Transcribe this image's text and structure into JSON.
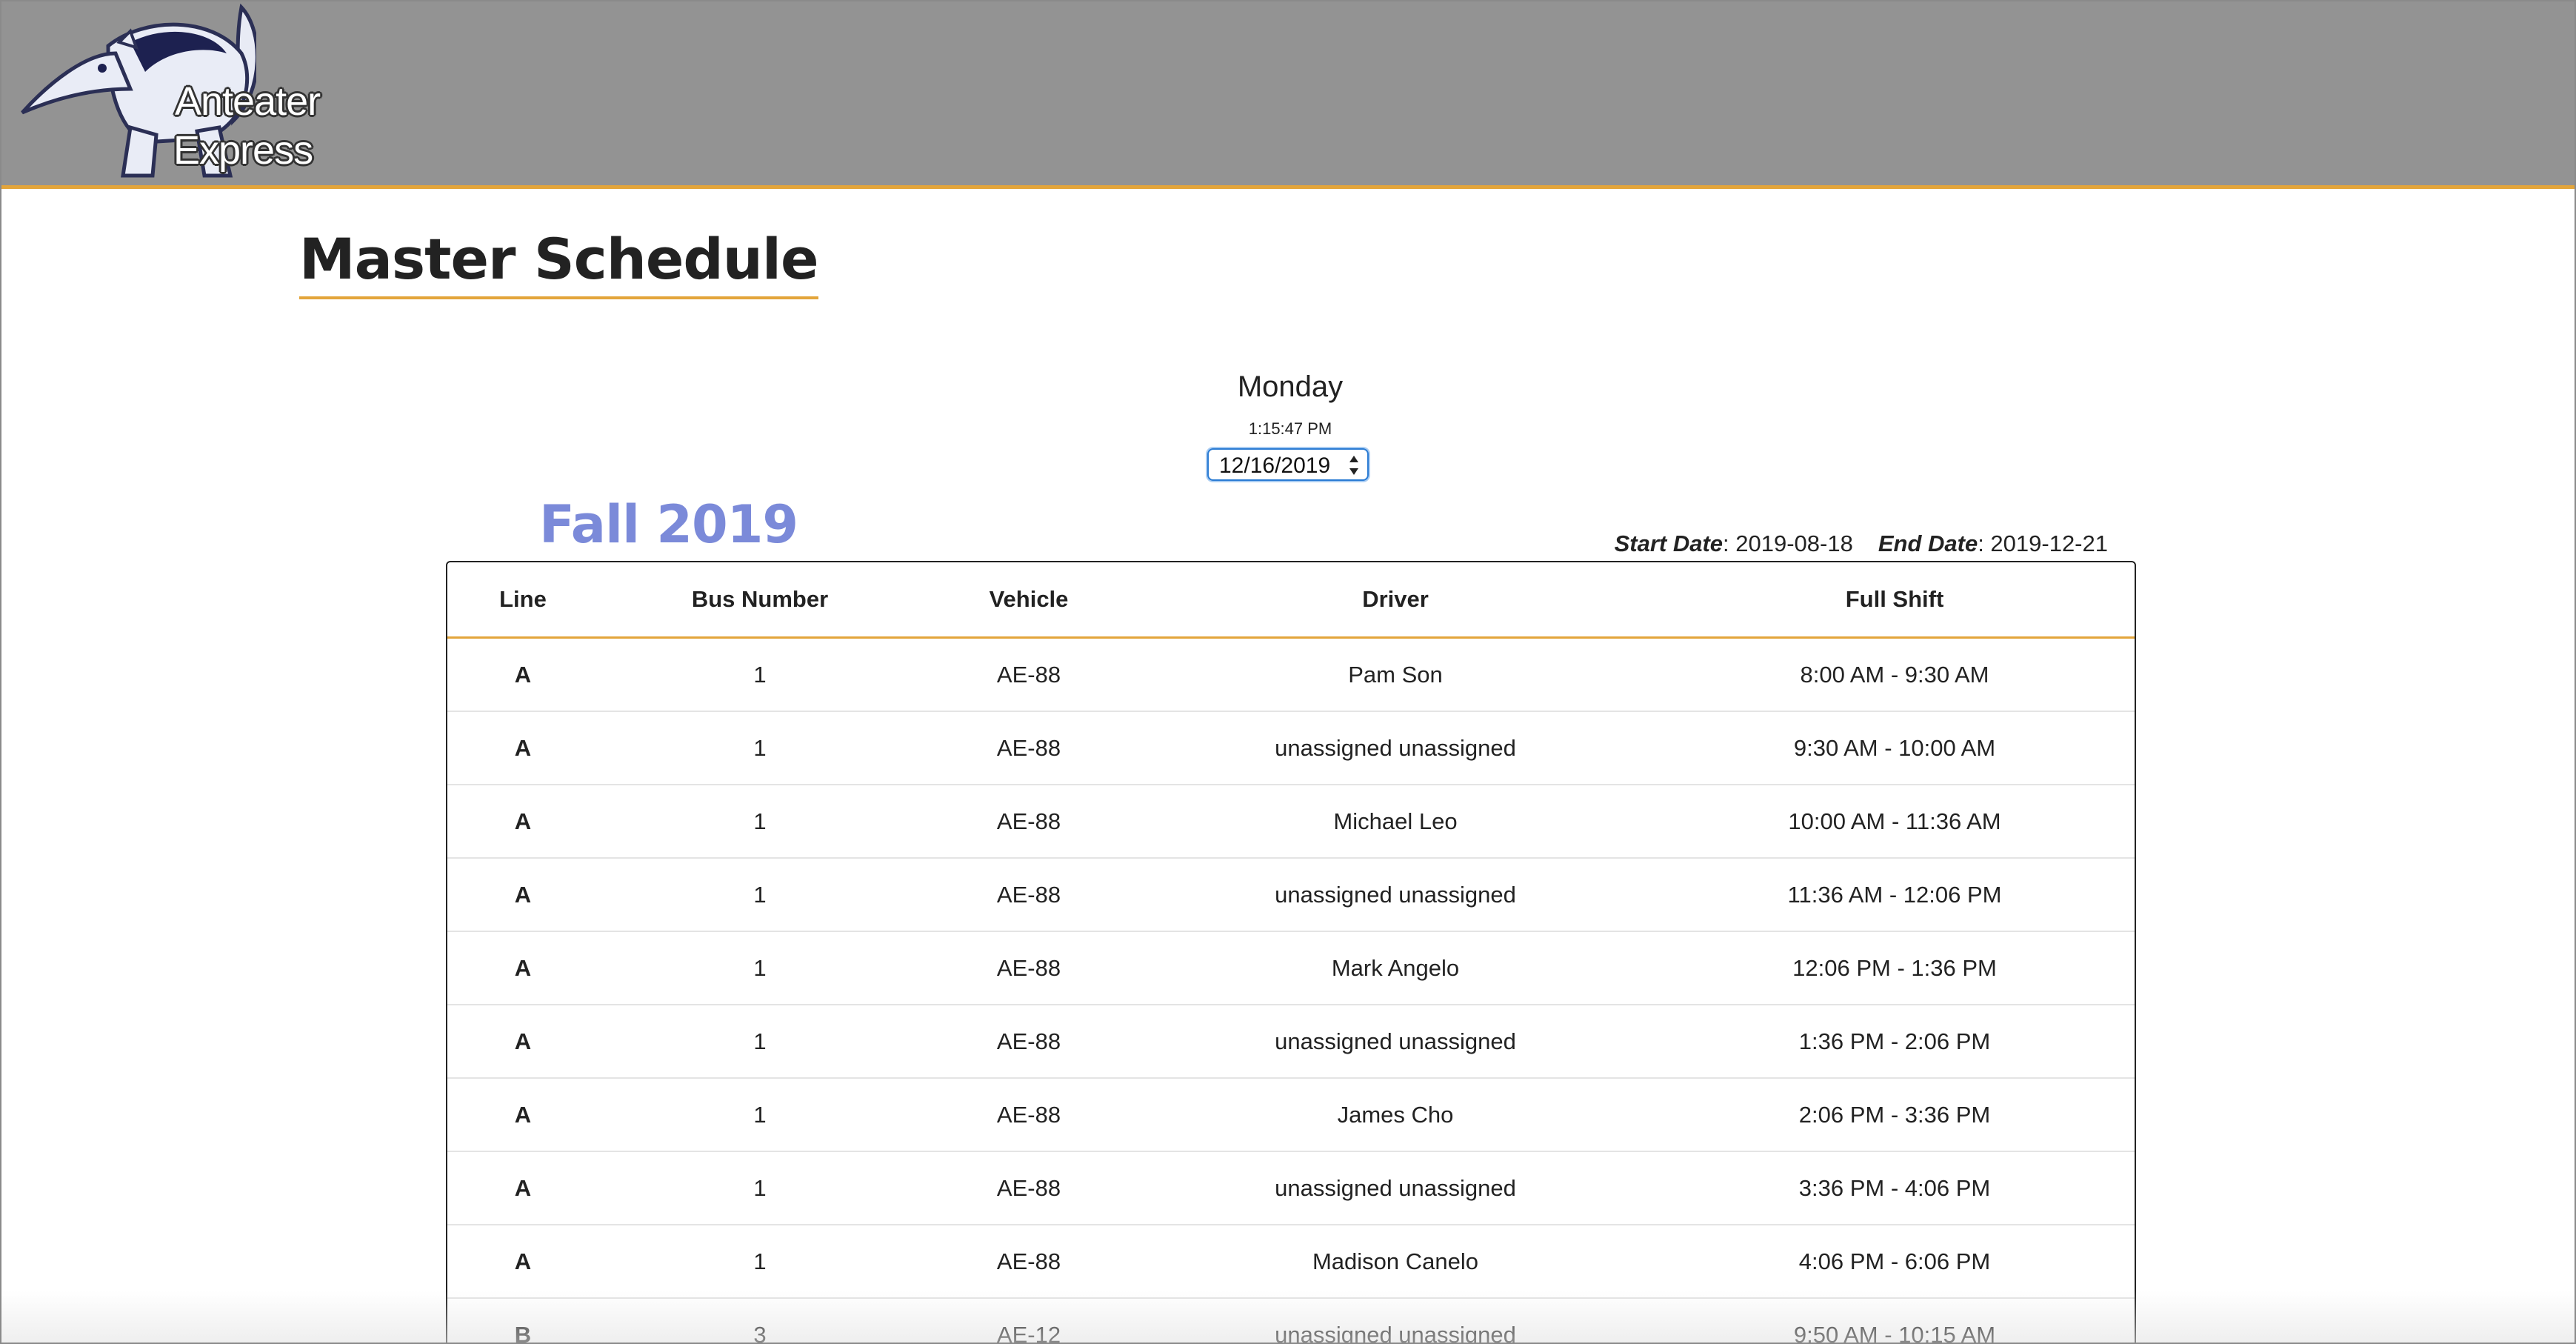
{
  "brand": {
    "line1": "Anteater",
    "line2": "Express",
    "logo_icon": "anteater-icon"
  },
  "page": {
    "title": "Master Schedule"
  },
  "day_display": {
    "day": "Monday",
    "time": "1:15:47 PM",
    "date_value": "12/16/2019"
  },
  "semester": {
    "name": "Fall 2019",
    "start_label": "Start Date",
    "start_value": ": 2019-08-18",
    "end_label": "End Date",
    "end_value": ": 2019-12-21"
  },
  "colors": {
    "header_bg": "#939393",
    "accent": "#e3a53b",
    "semester": "#7b8ad9",
    "focus": "#2a7bd3"
  },
  "table": {
    "headers": [
      "Line",
      "Bus Number",
      "Vehicle",
      "Driver",
      "Full Shift"
    ],
    "rows": [
      [
        "A",
        "1",
        "AE-88",
        "Pam Son",
        "8:00 AM - 9:30 AM"
      ],
      [
        "A",
        "1",
        "AE-88",
        "unassigned unassigned",
        "9:30 AM - 10:00 AM"
      ],
      [
        "A",
        "1",
        "AE-88",
        "Michael Leo",
        "10:00 AM - 11:36 AM"
      ],
      [
        "A",
        "1",
        "AE-88",
        "unassigned unassigned",
        "11:36 AM - 12:06 PM"
      ],
      [
        "A",
        "1",
        "AE-88",
        "Mark Angelo",
        "12:06 PM - 1:36 PM"
      ],
      [
        "A",
        "1",
        "AE-88",
        "unassigned unassigned",
        "1:36 PM - 2:06 PM"
      ],
      [
        "A",
        "1",
        "AE-88",
        "James Cho",
        "2:06 PM - 3:36 PM"
      ],
      [
        "A",
        "1",
        "AE-88",
        "unassigned unassigned",
        "3:36 PM - 4:06 PM"
      ],
      [
        "A",
        "1",
        "AE-88",
        "Madison Canelo",
        "4:06 PM - 6:06 PM"
      ],
      [
        "B",
        "3",
        "AE-12",
        "unassigned unassigned",
        "9:50 AM - 10:15 AM"
      ]
    ]
  }
}
